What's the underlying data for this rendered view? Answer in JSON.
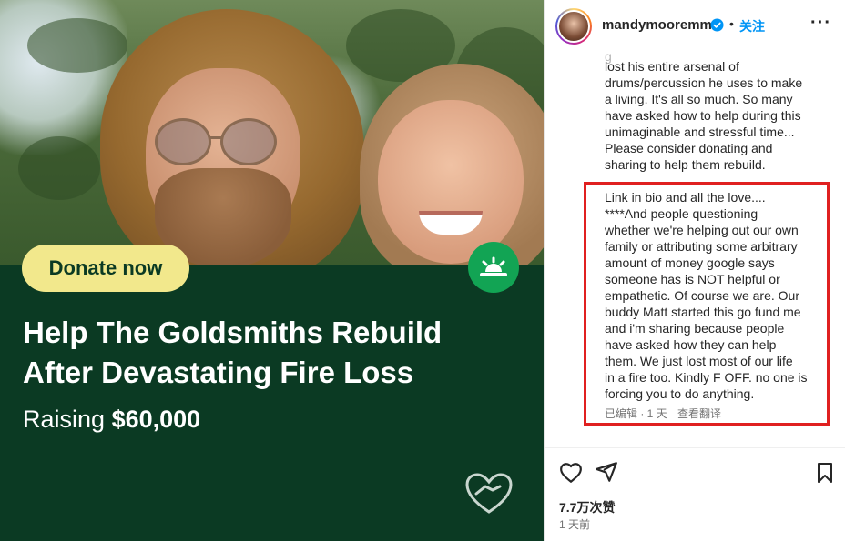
{
  "media": {
    "donate_label": "Donate now",
    "title": "Help The Goldsmiths Rebuild After Devastating Fire Loss",
    "raising_prefix": "Raising",
    "raising_amount": "$60,000",
    "colors": {
      "panel": "#0b3a23",
      "button": "#f2e88c",
      "badge": "#12a454"
    }
  },
  "header": {
    "username": "mandymooremm",
    "separator": "•",
    "follow_label": "关注",
    "more_label": "···",
    "verified_color": "#0095f6"
  },
  "caption": {
    "fade_line": "g",
    "part1": "lost his entire arsenal of\ndrums/percussion he uses to make\na living. It's all so much. So many\nhave asked how to help during this\nunimaginable and stressful time...\nPlease consider donating and\nsharing to help them rebuild.",
    "part2": "Link in bio and all the love....\n****And people questioning\nwhether we're helping out our own\nfamily or attributing some arbitrary\namount of money google says\nsomeone has is NOT helpful or\nempathetic. Of course we are. Our\nbuddy Matt started this go fund me\nand i'm sharing because people\nhave asked how they can help\nthem. We just lost most of our life\nin a fire too. Kindly F OFF. no one is\nforcing you to do anything.",
    "edited": "已编辑 · 1 天",
    "translate_label": "查看翻译",
    "highlight_color": "#e02020"
  },
  "footer": {
    "likes": "7.7万次赞",
    "time_ago": "1 天前",
    "icons": [
      "heart-icon",
      "share-icon",
      "bookmark-icon"
    ]
  }
}
